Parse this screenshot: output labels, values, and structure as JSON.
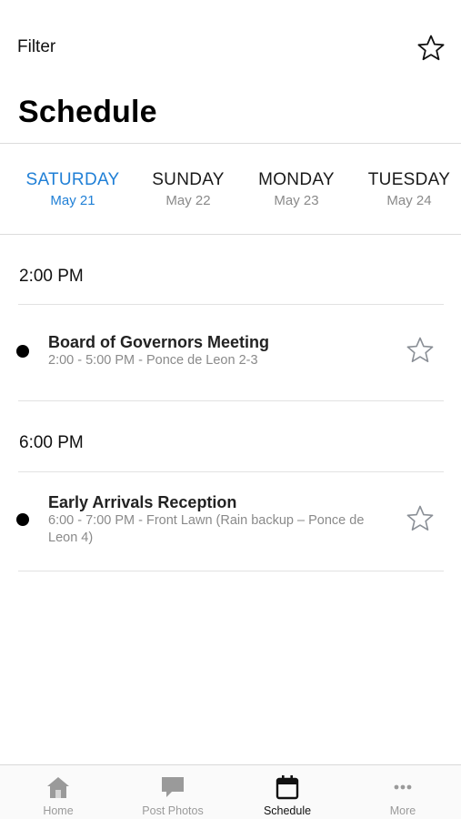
{
  "header": {
    "filter_label": "Filter",
    "favorites_icon": "star-outline-icon",
    "title": "Schedule"
  },
  "days": [
    {
      "name": "SATURDAY",
      "date": "May 21",
      "selected": true
    },
    {
      "name": "SUNDAY",
      "date": "May 22",
      "selected": false
    },
    {
      "name": "MONDAY",
      "date": "May 23",
      "selected": false
    },
    {
      "name": "TUESDAY",
      "date": "May 24",
      "selected": false
    }
  ],
  "groups": [
    {
      "time": "2:00 PM",
      "sessions": [
        {
          "title": "Board of Governors Meeting",
          "details": "2:00 - 5:00 PM - Ponce de Leon 2-3"
        }
      ]
    },
    {
      "time": "6:00 PM",
      "sessions": [
        {
          "title": "Early Arrivals Reception",
          "details": "6:00 - 7:00 PM - Front Lawn (Rain backup – Ponce de Leon 4)"
        }
      ]
    }
  ],
  "tabbar": {
    "items": [
      {
        "label": "Home",
        "icon": "home-icon"
      },
      {
        "label": "Post Photos",
        "icon": "chat-bubble-icon"
      },
      {
        "label": "Schedule",
        "icon": "calendar-icon",
        "selected": true
      },
      {
        "label": "More",
        "icon": "more-dots-icon"
      }
    ]
  },
  "colors": {
    "accent": "#1f7fd6",
    "muted_text": "#8a8a8a",
    "divider": "#dcdcdc",
    "tab_icon_inactive": "#9a9a9a"
  }
}
